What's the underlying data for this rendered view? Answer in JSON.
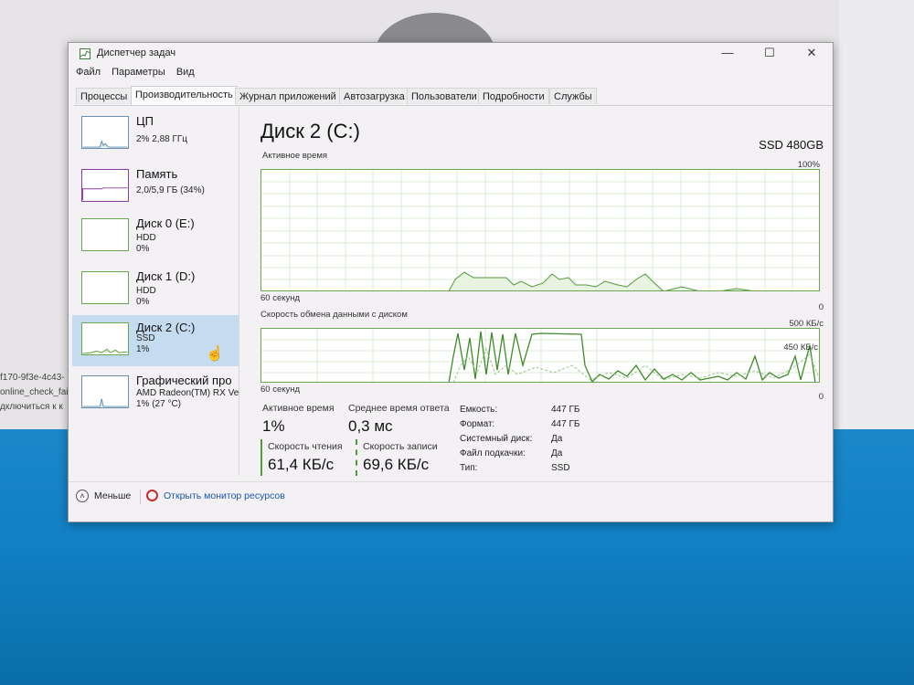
{
  "window": {
    "title": "Диспетчер задач",
    "controls": {
      "minimize": "—",
      "maximize": "☐",
      "close": "✕"
    }
  },
  "menu": [
    "Файл",
    "Параметры",
    "Вид"
  ],
  "tabs": [
    "Процессы",
    "Производительность",
    "Журнал приложений",
    "Автозагрузка",
    "Пользователи",
    "Подробности",
    "Службы"
  ],
  "active_tab": "Производительность",
  "sidebar": {
    "items": [
      {
        "name": "ЦП",
        "line1": "2% 2,88 ГГц",
        "line2": ""
      },
      {
        "name": "Память",
        "line1": "2,0/5,9 ГБ (34%)",
        "line2": ""
      },
      {
        "name": "Диск 0 (E:)",
        "line1": "HDD",
        "line2": "0%"
      },
      {
        "name": "Диск 1 (D:)",
        "line1": "HDD",
        "line2": "0%"
      },
      {
        "name": "Диск 2 (C:)",
        "line1": "SSD",
        "line2": "1%"
      },
      {
        "name": "Графический про",
        "line1": "AMD Radeon(TM) RX Ve",
        "line2": "1% (27 °C)"
      }
    ],
    "selected_index": 4
  },
  "main": {
    "title": "Диск 2 (C:)",
    "model": "SSD 480GB",
    "graph1": {
      "label": "Активное время",
      "max_label": "100%",
      "time_label": "60 секунд",
      "min_label": "0"
    },
    "graph2": {
      "label": "Скорость обмена данными с диском",
      "max_label": "500 КБ/с",
      "secondary_label": "450 КБ/с",
      "time_label": "60 секунд",
      "min_label": "0"
    },
    "stats": {
      "active_time_label": "Активное время",
      "active_time_value": "1%",
      "response_label": "Среднее время ответа",
      "response_value": "0,3 мс",
      "read_label": "Скорость чтения",
      "read_value": "61,4 КБ/с",
      "write_label": "Скорость записи",
      "write_value": "69,6 КБ/с"
    },
    "info": [
      {
        "key": "Емкость:",
        "value": "447 ГБ"
      },
      {
        "key": "Формат:",
        "value": "447 ГБ"
      },
      {
        "key": "Системный диск:",
        "value": "Да"
      },
      {
        "key": "Файл подкачки:",
        "value": "Да"
      },
      {
        "key": "Тип:",
        "value": "SSD"
      }
    ]
  },
  "footer": {
    "less_label": "Меньше",
    "resource_monitor_label": "Открыть монитор ресурсов"
  },
  "background_text": [
    "f170-9f3e-4c43-",
    "online_check_fai",
    "дключиться к к"
  ],
  "colors": {
    "accent_green": "#4f9a3a",
    "selected_bg": "#c5dcf0",
    "link": "#1a56a8"
  }
}
